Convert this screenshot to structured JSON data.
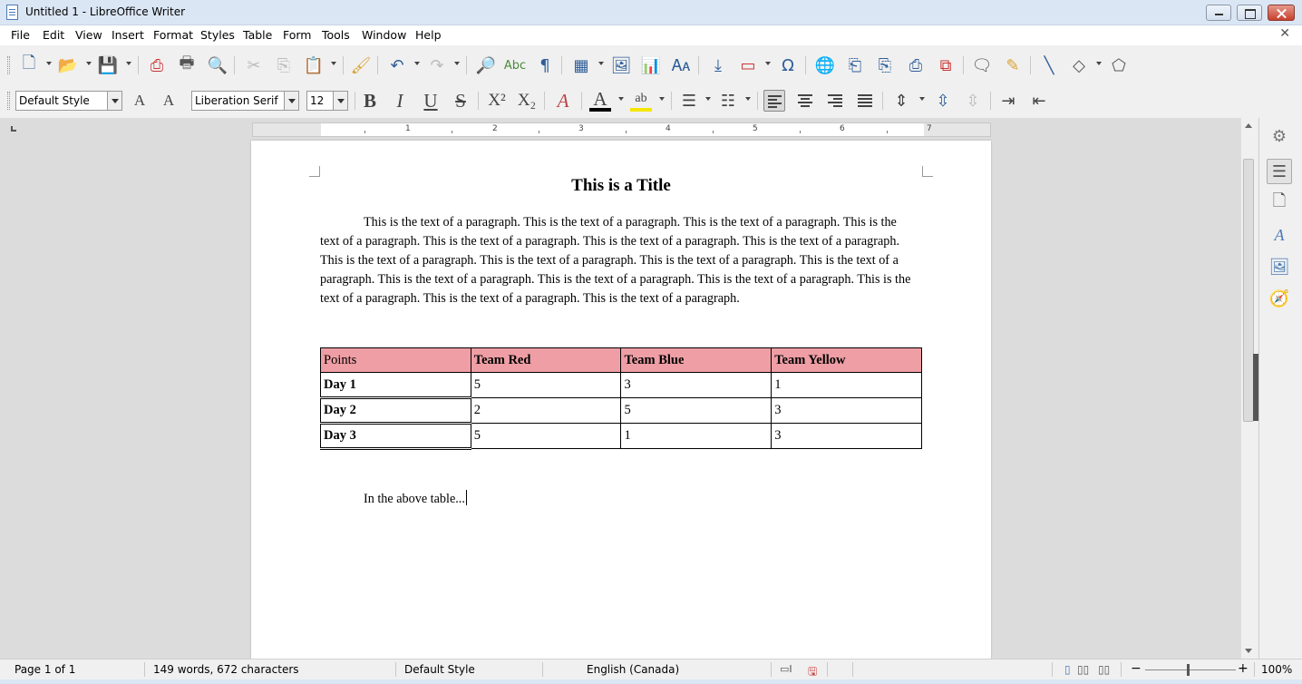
{
  "window": {
    "title": "Untitled 1 - LibreOffice Writer"
  },
  "menu": [
    "File",
    "Edit",
    "View",
    "Insert",
    "Format",
    "Styles",
    "Table",
    "Form",
    "Tools",
    "Window",
    "Help"
  ],
  "formatting": {
    "paragraph_style": "Default Style",
    "font_name": "Liberation Serif",
    "font_size": "12"
  },
  "document": {
    "title": "This is a Title",
    "paragraph": "This is the text of a paragraph.  This is the text of a paragraph.  This is the text of a paragraph.  This is the text of a paragraph.  This is the text of a paragraph.  This is the text of a paragraph.  This is the text of a paragraph.  This is the text of a paragraph.  This is the text of a paragraph.  This is the text of a paragraph.  This is the text of a paragraph.  This is the text of a paragraph.  This is the text of a paragraph.  This is the text of a paragraph.  This is the text of a paragraph.  This is the text of a paragraph.  This is the text of a paragraph.",
    "table": {
      "header": [
        "Points",
        "Team Red",
        "Team Blue",
        "Team Yellow"
      ],
      "rows": [
        [
          "Day 1",
          "5",
          "3",
          "1"
        ],
        [
          "Day 2",
          "2",
          "5",
          "3"
        ],
        [
          "Day 3",
          "5",
          "1",
          "3"
        ]
      ],
      "header_color": "#ee9ea4"
    },
    "after_text": "In the above table..."
  },
  "ruler": {
    "labels": [
      "1",
      "2",
      "3",
      "4",
      "5",
      "6",
      "7"
    ]
  },
  "status": {
    "page": "Page 1 of 1",
    "words": "149 words, 672 characters",
    "style": "Default Style",
    "language": "English (Canada)",
    "zoom": "100%"
  }
}
